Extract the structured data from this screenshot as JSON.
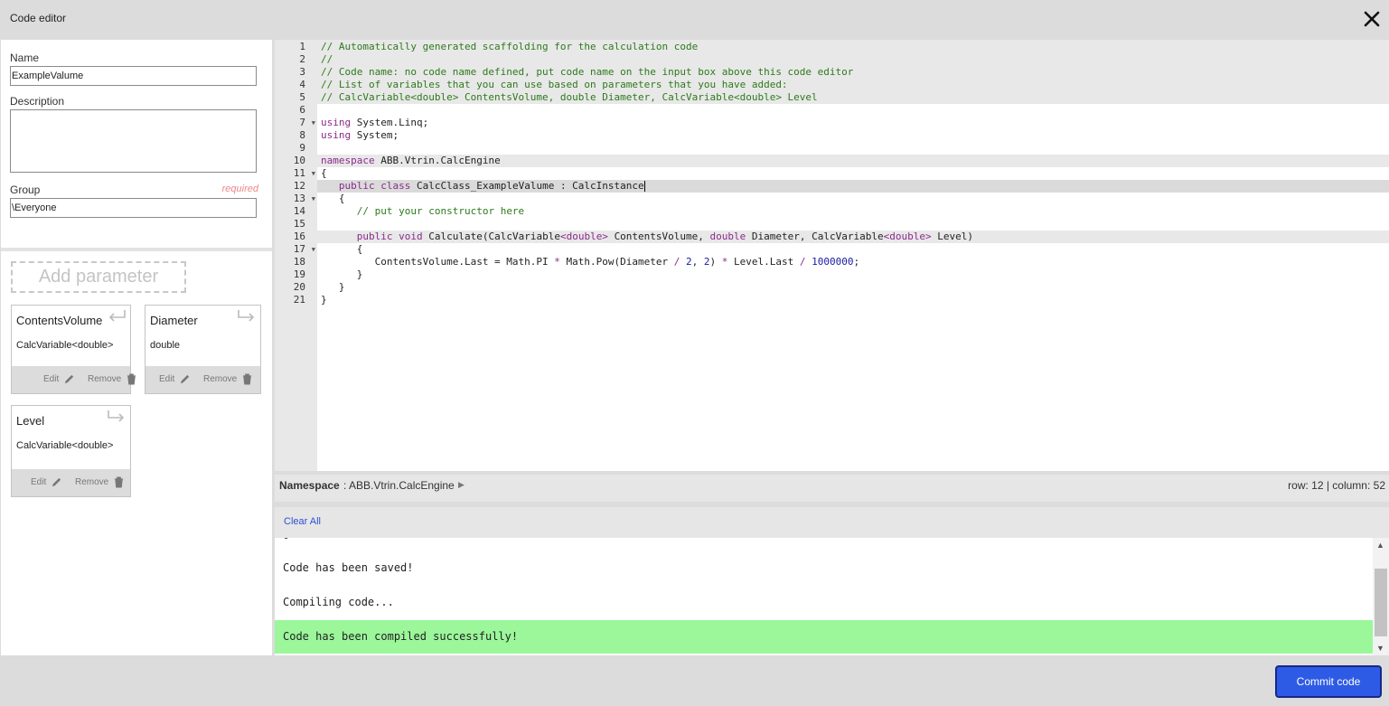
{
  "dialog": {
    "title": "Code editor"
  },
  "form": {
    "name_label": "Name",
    "name_value": "ExampleValume",
    "description_label": "Description",
    "description_value": "",
    "group_label": "Group",
    "group_required": "required",
    "group_value": "\\Everyone"
  },
  "parameters": {
    "add_label": "Add parameter",
    "items": [
      {
        "name": "ContentsVolume",
        "type": "CalcVariable<double>",
        "direction": "output",
        "edit": "Edit",
        "remove": "Remove"
      },
      {
        "name": "Diameter",
        "type": "double",
        "direction": "input",
        "edit": "Edit",
        "remove": "Remove"
      },
      {
        "name": "Level",
        "type": "CalcVariable<double>",
        "direction": "input",
        "edit": "Edit",
        "remove": "Remove"
      }
    ]
  },
  "editor": {
    "line_numbers": [
      "1",
      "2",
      "3",
      "4",
      "5",
      "6",
      "7",
      "8",
      "9",
      "10",
      "11",
      "12",
      "13",
      "14",
      "15",
      "16",
      "17",
      "18",
      "19",
      "20",
      "21"
    ],
    "fold_lines": [
      "7",
      "11",
      "13",
      "17"
    ],
    "lines": [
      "// Automatically generated scaffolding for the calculation code",
      "//",
      "// Code name: no code name defined, put code name on the input box above this code editor",
      "// List of variables that you can use based on parameters that you have added:",
      "// CalcVariable<double> ContentsVolume, double Diameter, CalcVariable<double> Level",
      "",
      "using System.Linq;",
      "using System;",
      "",
      "namespace ABB.Vtrin.CalcEngine",
      "{",
      "   public class CalcClass_ExampleValume : CalcInstance",
      "   {",
      "      // put your constructor here",
      "",
      "      public void Calculate(CalcVariable<double> ContentsVolume, double Diameter, CalcVariable<double> Level)",
      "      {",
      "         ContentsVolume.Last = Math.PI * Math.Pow(Diameter / 2, 2) * Level.Last / 1000000;",
      "      }",
      "   }",
      "}"
    ],
    "tokens": {
      "using": "using",
      "system_linq": "System.Linq;",
      "system": "System;",
      "namespace_kw": "namespace",
      "namespace_name": "ABB.Vtrin.CalcEngine",
      "public": "public",
      "class": "class",
      "class_decl": "CalcClass_ExampleValume : CalcInstance",
      "ctor_comment": "// put your constructor here",
      "void": "void",
      "calc_open": "Calculate(CalcVariable",
      "lt_double_gt": "<double>",
      "contents_param": "ContentsVolume,",
      "double": "double",
      "diameter_param": "Diameter, CalcVariable",
      "level_param": "Level)",
      "body_a": "ContentsVolume.Last = Math.PI",
      "star": "*",
      "body_b": "Math.Pow(Diameter",
      "slash": "/",
      "two": "2",
      "comma": ",",
      "body_c": ")",
      "body_d": "Level.Last",
      "million": "1000000",
      "semi": ";",
      "brace_open": "{",
      "brace_close": "}"
    }
  },
  "status": {
    "namespace_label": "Namespace",
    "namespace_value": ": ABB.Vtrin.CalcEngine",
    "position": "row: 12 | column: 52"
  },
  "output": {
    "clear_all": "Clear All",
    "partial": "-",
    "messages": [
      "Code has been saved!",
      "Compiling code...",
      "Code has been compiled successfully!"
    ],
    "success_color": "#9bf79a"
  },
  "footer": {
    "commit_label": "Commit code"
  },
  "colors": {
    "accent": "#2e5be5",
    "comment": "#2d7a1b",
    "keyword": "#8b2a8b",
    "number": "#1a1aa6"
  }
}
